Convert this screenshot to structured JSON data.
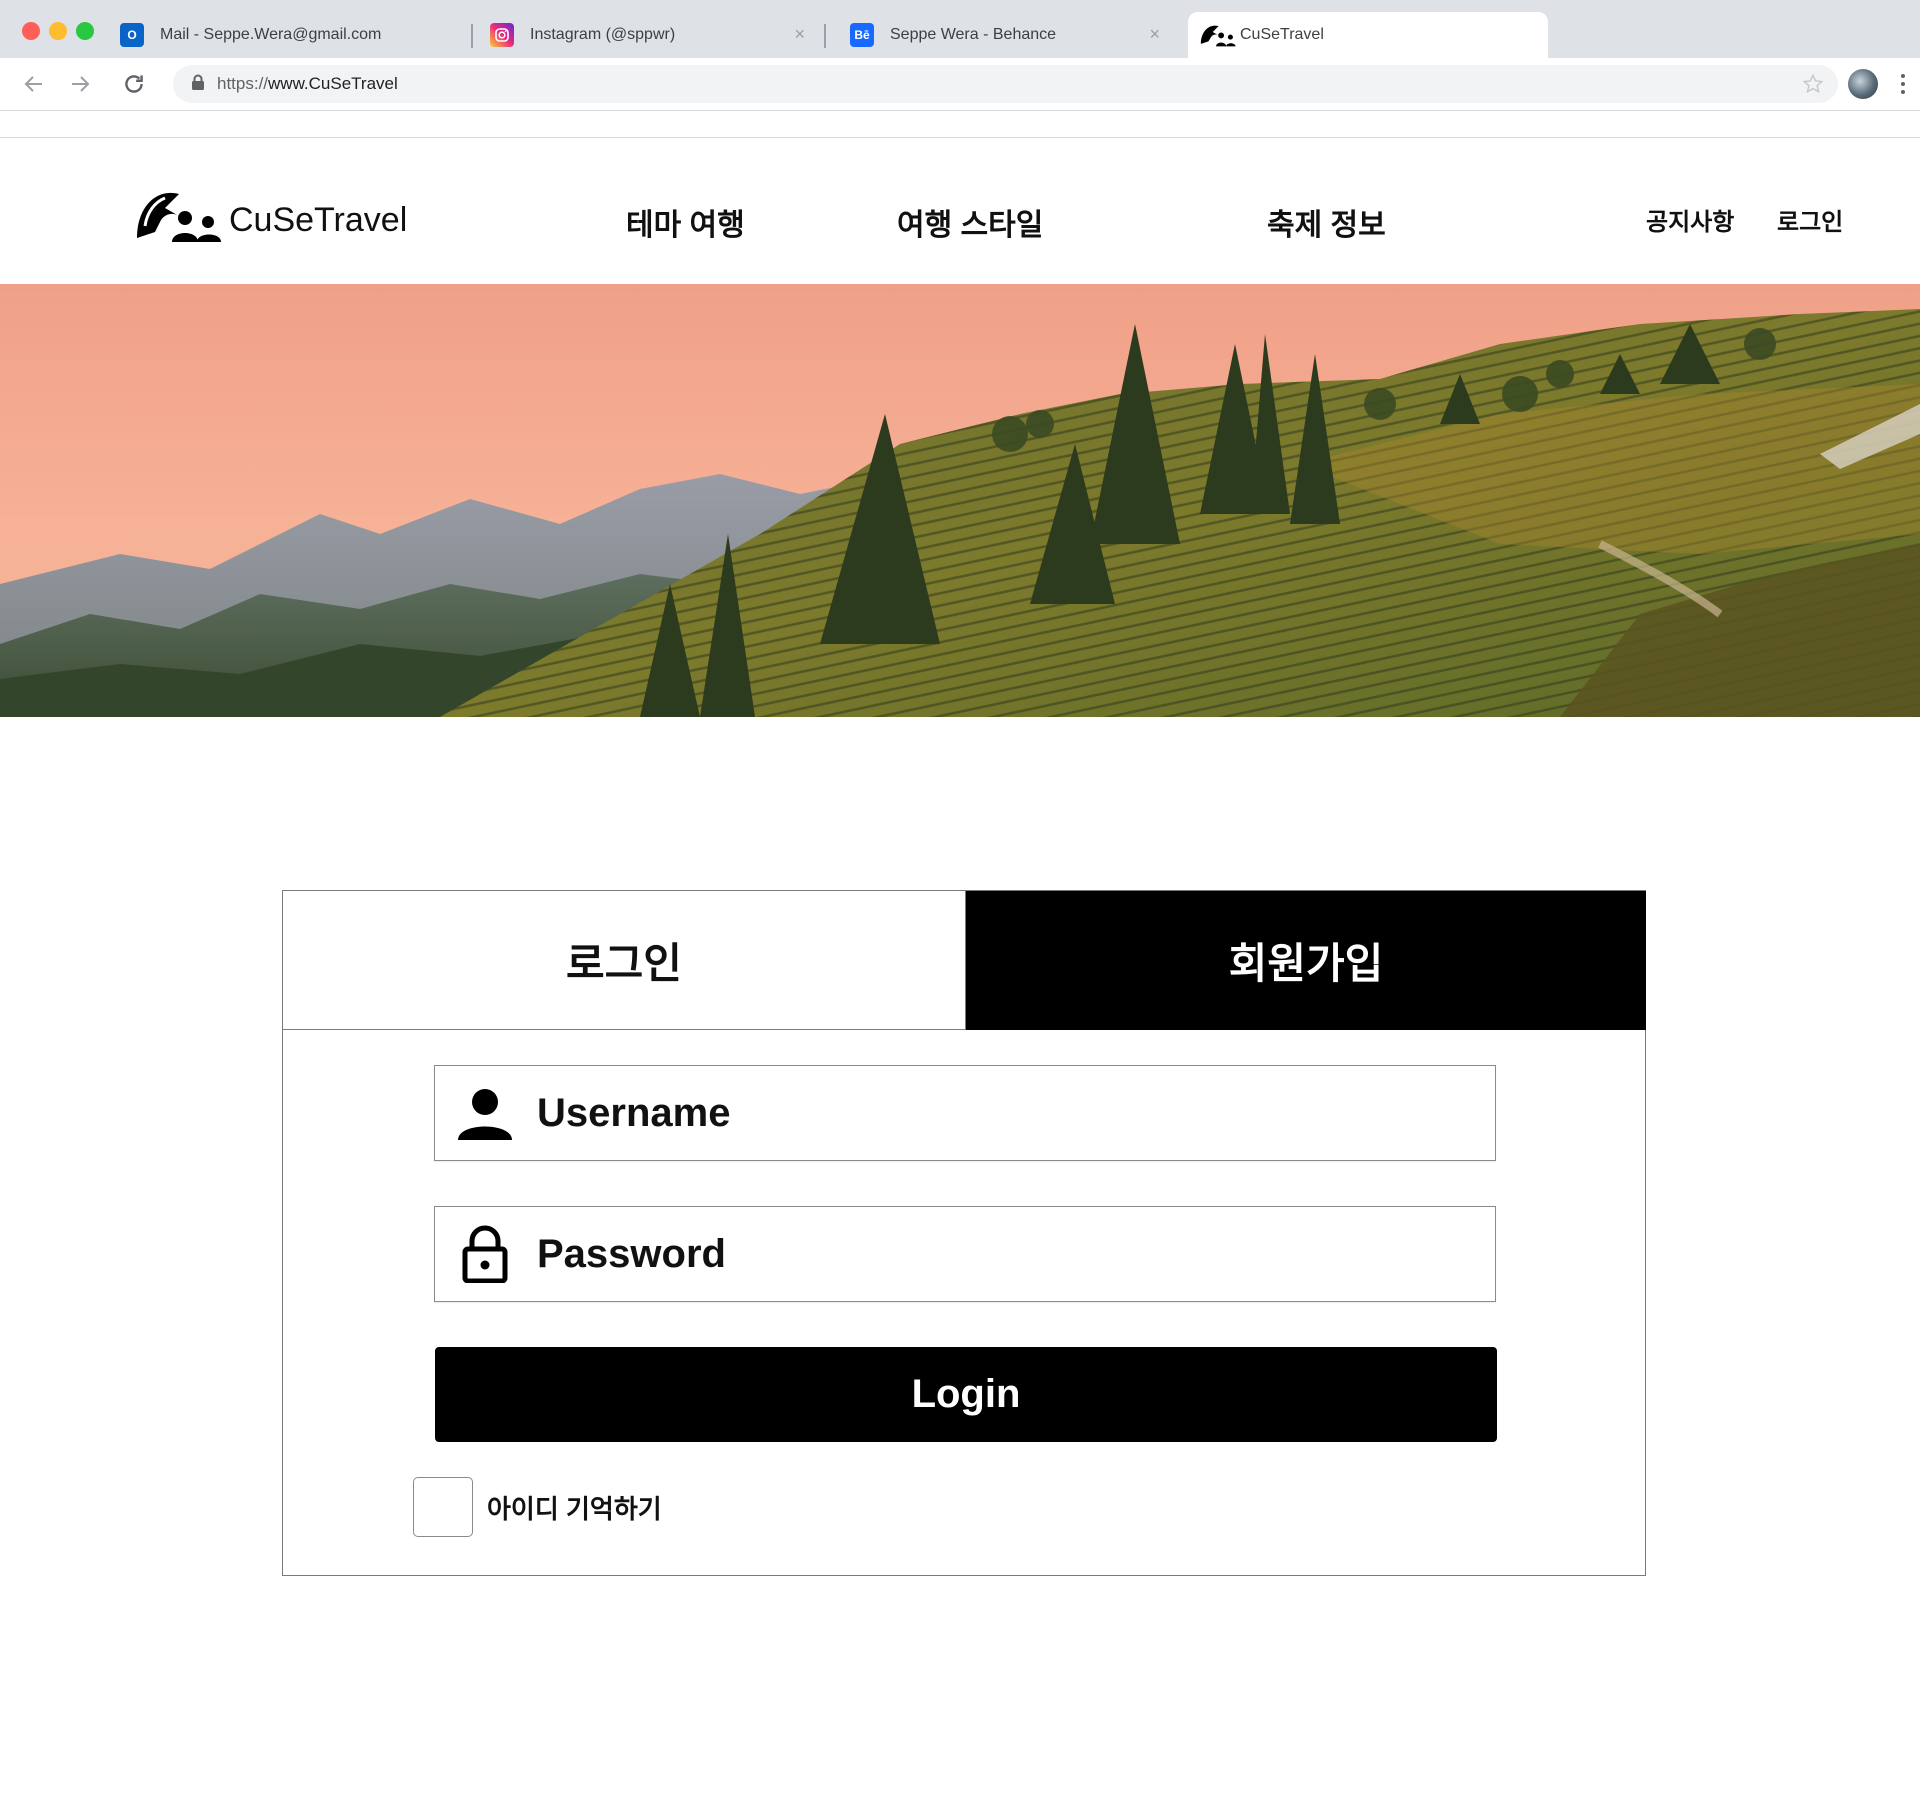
{
  "browser": {
    "tabs": [
      {
        "title": "Mail - Seppe.Wera@gmail.com",
        "icon": "outlook-icon"
      },
      {
        "title": "Instagram (@sppwr)",
        "icon": "instagram-icon"
      },
      {
        "title": "Seppe Wera - Behance",
        "icon": "behance-icon"
      },
      {
        "title": "CuSeTravel",
        "icon": "cusetravel-logo-icon",
        "active": true
      }
    ],
    "url_scheme": "https://",
    "url_host": "www.CuSeTravel"
  },
  "site": {
    "logo_text": "CuSeTravel",
    "menu": [
      "테마 여행",
      "여행 스타일",
      "축제 정보"
    ],
    "utility": [
      "공지사항",
      "로그인"
    ]
  },
  "auth": {
    "tab_login": "로그인",
    "tab_signup": "회원가입",
    "username_placeholder": "Username",
    "password_placeholder": "Password",
    "login_button": "Login",
    "remember_label": "아이디 기억하기",
    "remember_checked": false
  },
  "colors": {
    "accent": "#000000",
    "tab_strip": "#dee1e6",
    "sky_top": "#f2a98e",
    "hill_green": "#6f7a2e"
  }
}
